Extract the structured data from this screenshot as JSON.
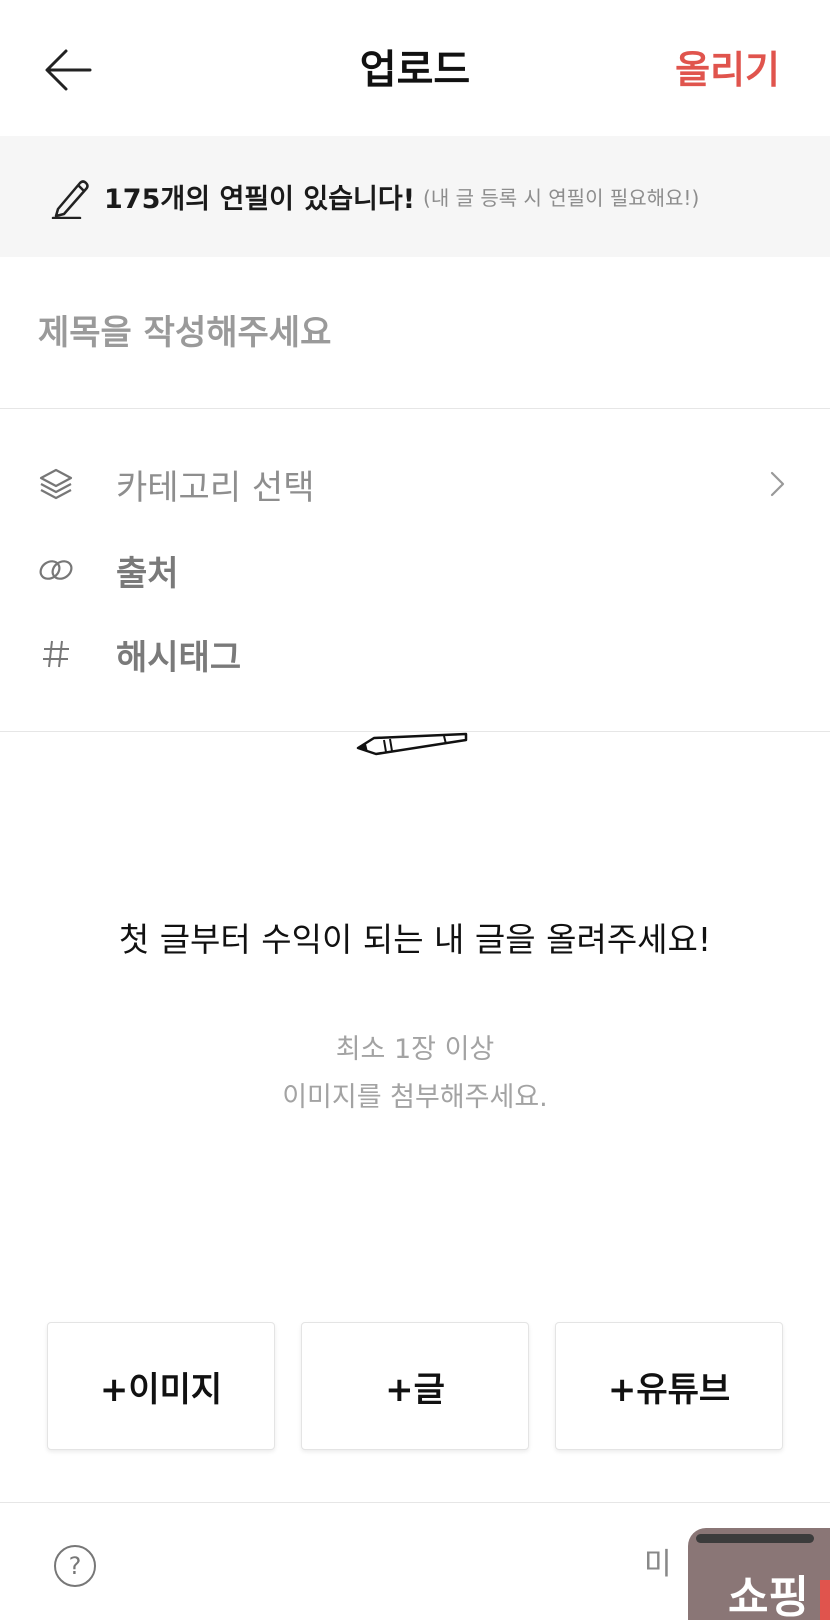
{
  "header": {
    "title": "업로드",
    "submit_label": "올리기",
    "accent_color": "#e0544d"
  },
  "banner": {
    "icon": "pencil-icon",
    "main_text": "175개의 연필이 있습니다!",
    "sub_text": "(내 글 등록 시 연필이 필요해요!)"
  },
  "title_field": {
    "placeholder": "제목을 작성해주세요",
    "value": ""
  },
  "options": [
    {
      "icon": "layers-icon",
      "label": "카테고리 선택",
      "has_chevron": true
    },
    {
      "icon": "link-icon",
      "label": "출처"
    },
    {
      "icon": "hash-icon",
      "label": "해시태그"
    }
  ],
  "empty_state": {
    "headline": "첫 글부터 수익이 되는 내 글을 올려주세요!",
    "sub_line1": "최소 1장 이상",
    "sub_line2": "이미지를 첨부해주세요."
  },
  "add_buttons": {
    "image": "+이미지",
    "text": "+글",
    "youtube": "+유튜브"
  },
  "bottom_bar": {
    "help_label": "?",
    "right_text": "미"
  },
  "floating_widget": {
    "text": "쇼핑"
  }
}
